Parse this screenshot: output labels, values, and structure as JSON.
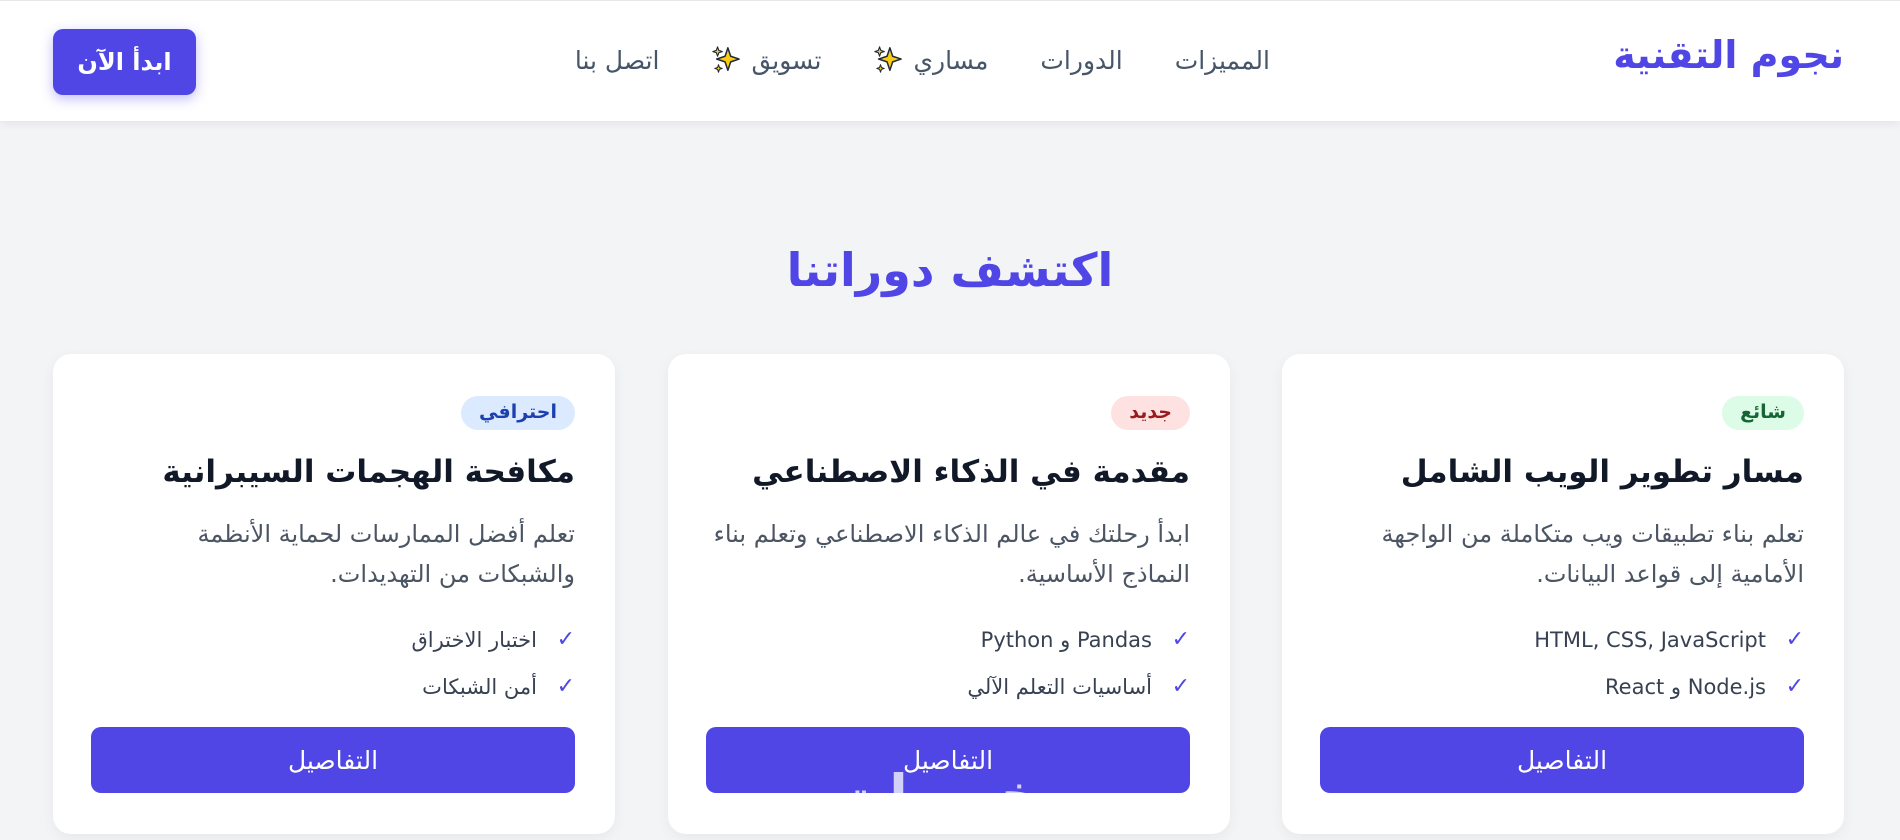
{
  "header": {
    "brand": "نجوم التقنية",
    "nav": [
      {
        "label": "المميزات"
      },
      {
        "label": "الدورات"
      },
      {
        "label": "مساري",
        "icon": "sparkles-icon"
      },
      {
        "label": "تسويق",
        "icon": "sparkles-icon"
      },
      {
        "label": "اتصل بنا"
      }
    ],
    "cta_label": "ابدأ الآن"
  },
  "section": {
    "title": "اكتشف دوراتنا"
  },
  "cards": [
    {
      "badge": "شائع",
      "title": "مسار تطوير الويب الشامل",
      "description": "تعلم بناء تطبيقات ويب متكاملة من الواجهة الأمامية إلى قواعد البيانات.",
      "features": [
        "HTML, CSS, JavaScript",
        "Node.js و React"
      ],
      "button": "التفاصيل"
    },
    {
      "badge": "جديد",
      "title": "مقدمة في الذكاء الاصطناعي",
      "description": "ابدأ رحلتك في عالم الذكاء الاصطناعي وتعلم بناء النماذج الأساسية.",
      "features": [
        "Pandas و Python",
        "أساسيات التعلم الآلي"
      ],
      "button": "التفاصيل"
    },
    {
      "badge": "احترافي",
      "title": "مكافحة الهجمات السيبرانية",
      "description": "تعلم أفضل الممارسات لحماية الأنظمة والشبكات من التهديدات.",
      "features": [
        "اختبار الاختراق",
        "أمن الشبكات"
      ],
      "button": "التفاصيل"
    }
  ],
  "watermark": "خمسات",
  "colors": {
    "accent": "#4f46e5",
    "background": "#f3f4f6",
    "badge_green": "#dcfce7",
    "badge_red": "#fee2e2",
    "badge_blue": "#dbeafe"
  }
}
